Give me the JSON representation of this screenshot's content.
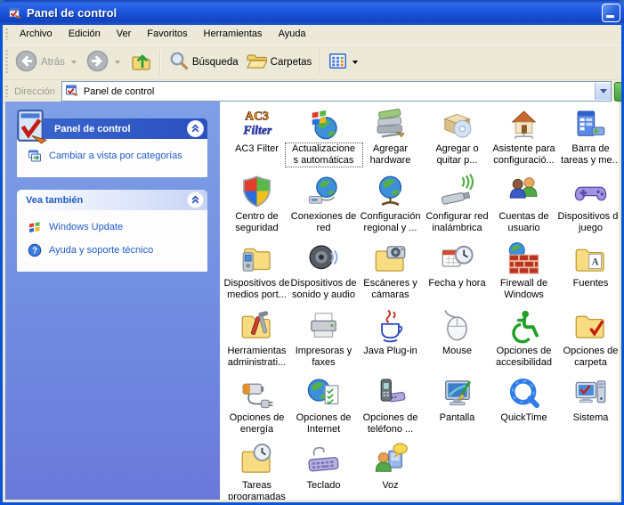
{
  "window": {
    "title": "Panel de control"
  },
  "menu": {
    "items": [
      "Archivo",
      "Edición",
      "Ver",
      "Favoritos",
      "Herramientas",
      "Ayuda"
    ]
  },
  "toolbar": {
    "back": "Atrás",
    "search": "Búsqueda",
    "folders": "Carpetas"
  },
  "address": {
    "label": "Dirección",
    "value": "Panel de control"
  },
  "sidebar": {
    "panel1": {
      "title": "Panel de control",
      "links": [
        {
          "label": "Cambiar a vista por categorías",
          "icon": "category-view"
        }
      ]
    },
    "panel2": {
      "title": "Vea también",
      "links": [
        {
          "label": "Windows Update",
          "icon": "windows-update"
        },
        {
          "label": "Ayuda y soporte técnico",
          "icon": "help-support"
        }
      ]
    }
  },
  "items": [
    {
      "label": "AC3 Filter",
      "icon": "ac3-filter"
    },
    {
      "label": "Actualizacione\ns automáticas",
      "icon": "automatic-updates",
      "selected": true
    },
    {
      "label": "Agregar\nhardware",
      "icon": "add-hardware"
    },
    {
      "label": "Agregar o\nquitar p...",
      "icon": "add-remove-programs"
    },
    {
      "label": "Asistente para\nconfiguració...",
      "icon": "network-setup-wizard"
    },
    {
      "label": "Barra de\ntareas y me...",
      "icon": "taskbar-start-menu"
    },
    {
      "label": "Centro de\nseguridad",
      "icon": "security-center"
    },
    {
      "label": "Conexiones de\nred",
      "icon": "network-connections"
    },
    {
      "label": "Configuración\nregional y ...",
      "icon": "regional-settings"
    },
    {
      "label": "Configurar red\ninalámbrica",
      "icon": "wireless-network"
    },
    {
      "label": "Cuentas de\nusuario",
      "icon": "user-accounts"
    },
    {
      "label": "Dispositivos de\njuego",
      "icon": "game-controllers"
    },
    {
      "label": "Dispositivos de\nmedios port...",
      "icon": "portable-media"
    },
    {
      "label": "Dispositivos de\nsonido y audio",
      "icon": "sounds-audio"
    },
    {
      "label": "Escáneres y\ncámaras",
      "icon": "scanners-cameras"
    },
    {
      "label": "Fecha y hora",
      "icon": "date-time"
    },
    {
      "label": "Firewall de\nWindows",
      "icon": "windows-firewall"
    },
    {
      "label": "Fuentes",
      "icon": "fonts"
    },
    {
      "label": "Herramientas\nadministrati...",
      "icon": "admin-tools"
    },
    {
      "label": "Impresoras y\nfaxes",
      "icon": "printers-faxes"
    },
    {
      "label": "Java Plug-in",
      "icon": "java-plugin"
    },
    {
      "label": "Mouse",
      "icon": "mouse"
    },
    {
      "label": "Opciones de\naccesibilidad",
      "icon": "accessibility"
    },
    {
      "label": "Opciones de\ncarpeta",
      "icon": "folder-options"
    },
    {
      "label": "Opciones de\nenergía",
      "icon": "power-options"
    },
    {
      "label": "Opciones de\nInternet",
      "icon": "internet-options"
    },
    {
      "label": "Opciones de\nteléfono ...",
      "icon": "phone-modem"
    },
    {
      "label": "Pantalla",
      "icon": "display"
    },
    {
      "label": "QuickTime",
      "icon": "quicktime"
    },
    {
      "label": "Sistema",
      "icon": "system"
    },
    {
      "label": "Tareas\nprogramadas",
      "icon": "scheduled-tasks"
    },
    {
      "label": "Teclado",
      "icon": "keyboard"
    },
    {
      "label": "Voz",
      "icon": "voice"
    }
  ],
  "colors": {
    "titlebar_blue": "#1D57DE",
    "window_border": "#0B54D6",
    "toolbar_face": "#ECE9D8",
    "sidebar_top": "#7FA0E6",
    "sidebar_bottom": "#6A78DA",
    "link_blue": "#215DC6"
  }
}
